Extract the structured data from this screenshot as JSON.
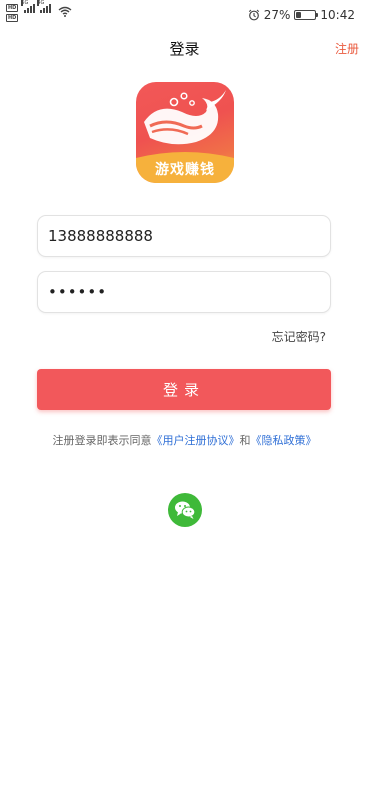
{
  "status_bar": {
    "sim1": "HD",
    "sim2": "HD",
    "network1": "5G",
    "network2": "4G",
    "battery_percent": "27%",
    "battery_level": 0.27,
    "time": "10:42",
    "icons": [
      "alarm-icon",
      "battery-icon",
      "wifi-icon",
      "signal-icon"
    ]
  },
  "nav": {
    "title": "登录",
    "register": "注册"
  },
  "logo": {
    "caption": "游戏赚钱",
    "colors": {
      "top": "#f25858",
      "bottom": "#f7a53a"
    }
  },
  "form": {
    "phone_value": "13888888888",
    "password_value": "••••••",
    "forgot": "忘记密码?",
    "login_label": "登录"
  },
  "agreement": {
    "prefix": "注册登录即表示同意",
    "user_agreement": "《用户注册协议》",
    "and": "和",
    "privacy_policy": "《隐私政策》"
  },
  "social": {
    "wechat_icon": "wechat-icon",
    "color": "#3fb939"
  },
  "colors": {
    "accent": "#f2585b",
    "link": "#2f6fd6",
    "register": "#ea5a3e"
  }
}
